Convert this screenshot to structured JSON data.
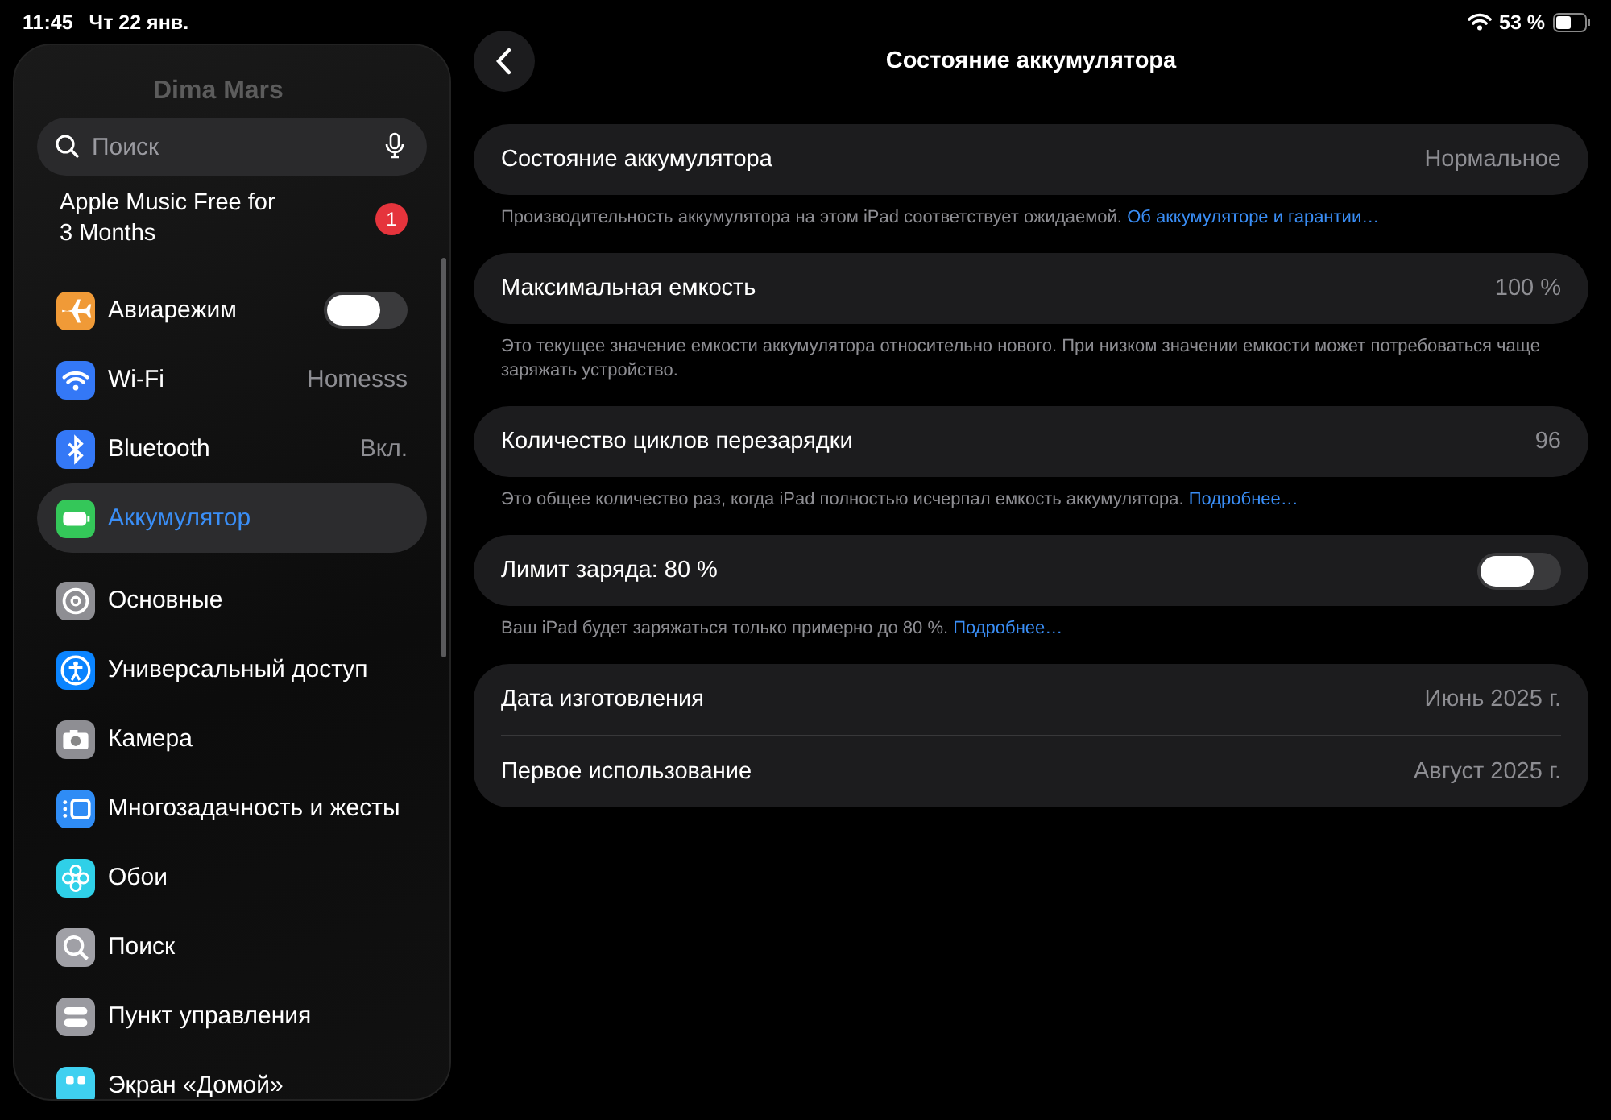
{
  "status_bar": {
    "time": "11:45",
    "date": "Чт 22 янв.",
    "battery": "53 %"
  },
  "sidebar": {
    "profile_name": "Dima Mars",
    "search": {
      "placeholder": "Поиск"
    },
    "promo": {
      "text": "Apple Music Free for 3 Months",
      "badge": "1"
    },
    "groups": [
      [
        {
          "kind": "toggle",
          "label": "Авиарежим",
          "on": false,
          "color": "#f09a37",
          "selected": false
        },
        {
          "kind": "value",
          "label": "Wi-Fi",
          "value": "Homesss",
          "color": "#3478f6",
          "selected": false
        },
        {
          "kind": "value",
          "label": "Bluetooth",
          "value": "Вкл.",
          "color": "#3478f6",
          "selected": false
        },
        {
          "kind": "plain",
          "label": "Аккумулятор",
          "color": "#34c759",
          "selected": true
        }
      ],
      [
        {
          "kind": "plain",
          "label": "Основные",
          "color": "#8e8e93",
          "selected": false
        },
        {
          "kind": "plain",
          "label": "Универсальный доступ",
          "color": "#0a84ff",
          "selected": false
        },
        {
          "kind": "plain",
          "label": "Камера",
          "color": "#8e8e93",
          "selected": false
        },
        {
          "kind": "plain",
          "label": "Многозадачность и жесты",
          "color": "#2f8cf5",
          "selected": false
        },
        {
          "kind": "plain",
          "label": "Обои",
          "color": "#2fd0e8",
          "selected": false
        },
        {
          "kind": "plain",
          "label": "Поиск",
          "color": "#a0a0a6",
          "selected": false
        },
        {
          "kind": "plain",
          "label": "Пункт управления",
          "color": "#9a9aa0",
          "selected": false
        },
        {
          "kind": "plain",
          "label": "Экран «Домой»",
          "color": "#3fd0f0",
          "selected": false
        }
      ]
    ]
  },
  "detail": {
    "title": "Состояние аккумулятора",
    "sections": [
      {
        "rows": [
          {
            "kind": "value",
            "label": "Состояние аккумулятора",
            "value": "Нормальное"
          }
        ],
        "note": {
          "text": "Производительность аккумулятора на этом iPad соответствует ожидаемой.",
          "link": "Об аккумуляторе и гарантии…"
        }
      },
      {
        "rows": [
          {
            "kind": "value",
            "label": "Максимальная емкость",
            "value": "100 %"
          }
        ],
        "note": {
          "text": "Это текущее значение емкости аккумулятора относительно нового. При низком значении емкости может потребоваться чаще заряжать устройство."
        }
      },
      {
        "rows": [
          {
            "kind": "value",
            "label": "Количество циклов перезарядки",
            "value": "96"
          }
        ],
        "note": {
          "text": "Это общее количество раз, когда iPad полностью исчерпал емкость аккумулятора.",
          "link": "Подробнее…"
        }
      },
      {
        "rows": [
          {
            "kind": "toggle",
            "label": "Лимит заряда: 80 %",
            "on": false
          }
        ],
        "note": {
          "text": "Ваш iPad будет заряжаться только примерно до 80 %.",
          "link": "Подробнее…"
        }
      },
      {
        "rows": [
          {
            "kind": "value",
            "label": "Дата изготовления",
            "value": "Июнь 2025 г."
          },
          {
            "kind": "value",
            "label": "Первое использование",
            "value": "Август 2025 г."
          }
        ]
      }
    ]
  }
}
